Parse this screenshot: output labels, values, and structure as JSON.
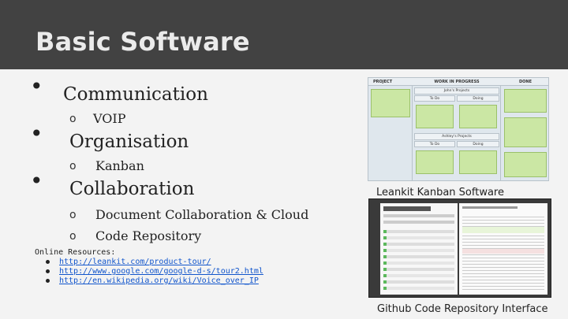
{
  "slide": {
    "title": "Basic Software",
    "bullets": [
      {
        "label": "Communication",
        "subs": [
          "VOIP"
        ]
      },
      {
        "label": "Organisation",
        "subs": [
          "Kanban"
        ]
      },
      {
        "label": "Collaboration",
        "subs": [
          "Document Collaboration & Cloud",
          "Code Repository"
        ]
      }
    ],
    "sub_marker": "o",
    "resources": {
      "title": "Online Resources:",
      "links": [
        "http://leankit.com/product-tour/",
        "http://www.google.com/google-d-s/tour2.html",
        "http://en.wikipedia.org/wiki/Voice_over_IP"
      ]
    },
    "images": {
      "kanban_caption": "Leankit Kanban Software",
      "github_caption": "Github Code Repository Interface"
    }
  },
  "kanban": {
    "columns": [
      "PROJECT",
      "WORK IN PROGRESS",
      "DONE"
    ],
    "lanes": [
      "John's Projects",
      "Ashley's Projects"
    ],
    "subcolumns": [
      "To Do",
      "Doing"
    ]
  },
  "colors": {
    "title_bar": "#424242",
    "title_text": "#ebebeb",
    "background": "#f3f3f3",
    "link": "#1155cc"
  }
}
